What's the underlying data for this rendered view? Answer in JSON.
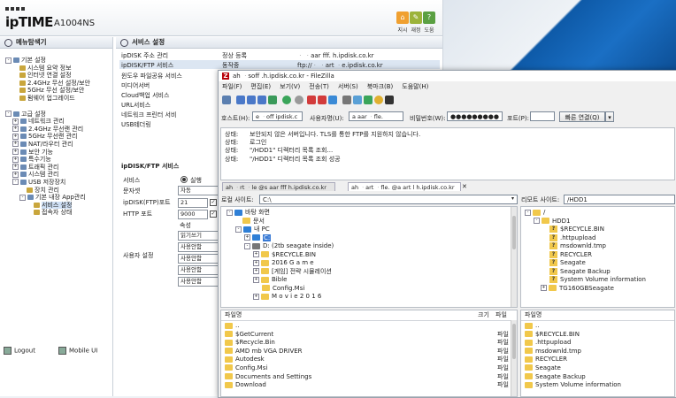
{
  "router": {
    "brand": "ipTIME",
    "model": "A1004NS",
    "top_buttons": [
      {
        "label": "지시",
        "color": "#f0a030",
        "icon": "home-icon"
      },
      {
        "label": "재정",
        "color": "#9cb33a",
        "icon": "settings-icon"
      },
      {
        "label": "도움",
        "color": "#5aa042",
        "icon": "help-icon"
      }
    ],
    "menu_title": "메뉴탐색기",
    "basic": {
      "title": "기본 설정",
      "items": [
        "시스템 요약 정보",
        "인터넷 연결 설정",
        "2.4GHz 무선 설정/보안",
        "5GHz 무선 설정/보안",
        "펌웨어 업그레이드"
      ]
    },
    "advanced": {
      "title": "고급 설정",
      "items": [
        "네트워크 관리",
        "2.4GHz 무선랜 관리",
        "5GHz 무선랜 관리",
        "NAT/라우터 관리",
        "보안 기능",
        "특수기능",
        "트래픽 관리",
        "시스템 관리"
      ],
      "usb": {
        "title": "USB 저장장치",
        "items": [
          "장치 관리"
        ],
        "app": {
          "title": "기본 내장 App관리",
          "items": [
            "서비스 설정",
            "접속자 상태"
          ]
        }
      }
    },
    "logout": "Logout",
    "mobile": "Mobile UI",
    "service_title": "서비스 설정",
    "services": [
      {
        "name": "ipDISK 주소 관리",
        "status": "정상 등록",
        "url": "ᆞ  ᆞaar  fff.  h.ipdisk.co.kr"
      },
      {
        "name": "ipDISK/FTP 서비스",
        "status": "동작중",
        "url": "ftp://ᆞ  ᆞart ᆞe.ipdisk.co.kr"
      },
      {
        "name": "윈도우 파일공유 서비스",
        "status": "",
        "url": ""
      },
      {
        "name": "미디어서버",
        "status": "",
        "url": ""
      },
      {
        "name": "Cloud백업 서비스",
        "status": "",
        "url": ""
      },
      {
        "name": "URL서비스",
        "status": "",
        "url": ""
      },
      {
        "name": "네트워크 프린터 서비",
        "status": "",
        "url": ""
      },
      {
        "name": "USB테더링",
        "status": "",
        "url": ""
      }
    ],
    "ftp_section": {
      "title": "ipDISK/FTP 서비스",
      "labels": [
        "서비스",
        "문자셋",
        "ipDISK(FTP)포트",
        "HTTP 포트"
      ],
      "service_radio": "실행",
      "charset": "자동",
      "ftp_port": "21",
      "http_port": "9000",
      "attr_label": "속성",
      "user_label": "사용자 설정",
      "attr_value": "읽기쓰기",
      "user_values": [
        "사용안함",
        "사용안함",
        "사용안함",
        "사용안함",
        "사용안함"
      ]
    }
  },
  "filezilla": {
    "title": "ah   ᆞsoff   .h.ipdisk.co.kr - FileZilla",
    "menu": [
      "파일(F)",
      "편집(E)",
      "보기(V)",
      "전송(T)",
      "서버(S)",
      "북마크(B)",
      "도움말(H)"
    ],
    "quickconnect": {
      "host_label": "호스트(H):",
      "host_value": "e   ᆞoff    ipdisk.c",
      "user_label": "사용자명(U):",
      "user_value": "a   aar    ᆞfle.",
      "pass_label": "비밀번호(W):",
      "pass_value": "●●●●●●●●●",
      "port_label": "포트(P):",
      "port_value": "",
      "connect_label": "빠른 연결(Q)"
    },
    "log": [
      {
        "k": "상태:",
        "v": "보안되지 않은 서버입니다. TLS를 통한 FTP를 지원하지 않습니다."
      },
      {
        "k": "상태:",
        "v": "로그인"
      },
      {
        "k": "상태:",
        "v": "\"/HDD1\" 디렉터리 목록 조회..."
      },
      {
        "k": "상태:",
        "v": "\"/HDD1\" 디렉터리 목록 조회 성공"
      }
    ],
    "tabs": [
      "ah   ᆞrt   ᆞle   @s   aar   fff  h.ipdisk.co.kr",
      "ah   ᆞart  ᆞfle.  @a   art  l  h.ipdisk.co.kr"
    ],
    "local": {
      "label": "로컬 사이트:",
      "path": "C:\\",
      "tree": [
        "바탕 화면",
        "문서",
        "내 PC",
        "C:",
        "D: (2tb seagate inside)",
        "$RECYCLE.BIN",
        "2016 G a m e",
        "[게임] 전략 시뮬레이션",
        "Bible",
        "Config.Msi",
        "M o v i e 2 0 1 6"
      ],
      "list_header": {
        "name": "파일명",
        "size": "크기",
        "type": "파일"
      },
      "files": [
        "..",
        "$GetCurrent",
        "$Recycle.Bin",
        "AMD mb VGA DRIVER",
        "Autodesk",
        "Config.Msi",
        "Documents and Settings",
        "Download"
      ],
      "file_type": "파일"
    },
    "remote": {
      "label": "리모트 사이트:",
      "path": "/HDD1",
      "tree": [
        "/",
        "HDD1",
        "$RECYCLE.BIN",
        ".httpupload",
        "msdownld.tmp",
        "RECYCLER",
        "Seagate",
        "Seagate Backup",
        "System Volume information",
        "TG160GBSeagate"
      ],
      "list_header": {
        "name": "파일명"
      },
      "files": [
        "..",
        "$RECYCLE.BIN",
        ".httpupload",
        "msdownld.tmp",
        "RECYCLER",
        "Seagate",
        "Seagate Backup",
        "System Volume information"
      ]
    }
  }
}
